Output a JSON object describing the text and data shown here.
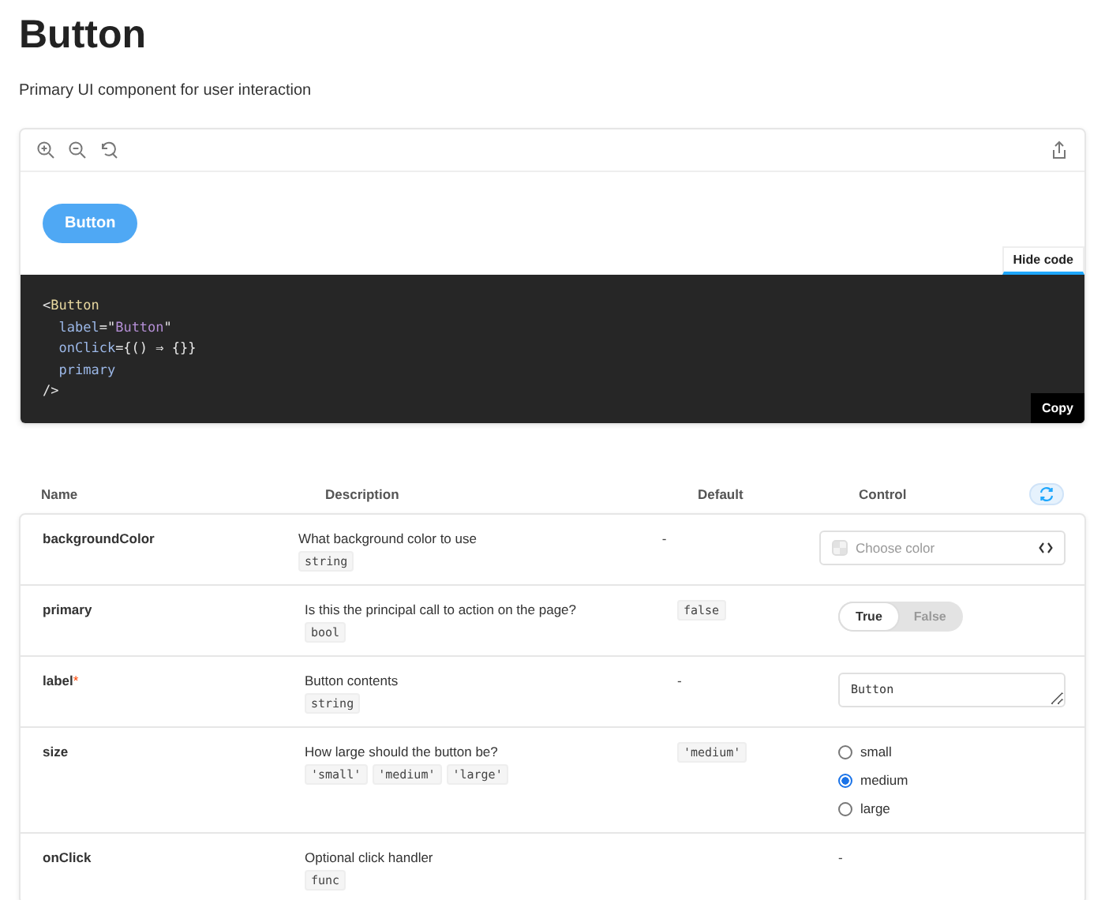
{
  "title": "Button",
  "subtitle": "Primary UI component for user interaction",
  "preview": {
    "button_label": "Button",
    "hide_code_label": "Hide code",
    "copy_label": "Copy",
    "code_lines": [
      {
        "tokens": [
          {
            "text": "<",
            "kind": "punct"
          },
          {
            "text": "Button",
            "kind": "tag"
          }
        ]
      },
      {
        "tokens": [
          {
            "text": "  label",
            "kind": "attr"
          },
          {
            "text": "=",
            "kind": "punct"
          },
          {
            "text": "\"",
            "kind": "punct"
          },
          {
            "text": "Button",
            "kind": "string"
          },
          {
            "text": "\"",
            "kind": "punct"
          }
        ]
      },
      {
        "tokens": [
          {
            "text": "  onClick",
            "kind": "attr"
          },
          {
            "text": "={() ⇒ {}}",
            "kind": "punct"
          }
        ]
      },
      {
        "tokens": [
          {
            "text": "  primary",
            "kind": "attr"
          }
        ]
      },
      {
        "tokens": [
          {
            "text": "/>",
            "kind": "punct"
          }
        ]
      }
    ]
  },
  "table": {
    "columns": [
      "Name",
      "Description",
      "Default",
      "Control"
    ],
    "rows": [
      {
        "name": "backgroundColor",
        "description": "What background color to use",
        "types": [
          "string"
        ],
        "default": {
          "kind": "text",
          "text": "-"
        },
        "control": {
          "kind": "color",
          "placeholder": "Choose color"
        }
      },
      {
        "name": "primary",
        "description": "Is this the principal call to action on the page?",
        "types": [
          "bool"
        ],
        "default": {
          "kind": "code",
          "text": "false"
        },
        "control": {
          "kind": "toggle",
          "options": [
            {
              "label": "True",
              "selected": true
            },
            {
              "label": "False",
              "selected": false
            }
          ]
        }
      },
      {
        "name": "label",
        "required_mark": "*",
        "description": "Button contents",
        "types": [
          "string"
        ],
        "default": {
          "kind": "text",
          "text": "-"
        },
        "control": {
          "kind": "text",
          "value": "Button"
        }
      },
      {
        "name": "size",
        "description": "How large should the button be?",
        "types": [
          "'small'",
          "'medium'",
          "'large'"
        ],
        "default": {
          "kind": "code",
          "text": "'medium'"
        },
        "control": {
          "kind": "radio",
          "options": [
            {
              "label": "small",
              "selected": false
            },
            {
              "label": "medium",
              "selected": true
            },
            {
              "label": "large",
              "selected": false
            }
          ]
        }
      },
      {
        "name": "onClick",
        "description": "Optional click handler",
        "types": [
          "func"
        ],
        "control": {
          "kind": "none",
          "text": "-"
        }
      }
    ]
  }
}
